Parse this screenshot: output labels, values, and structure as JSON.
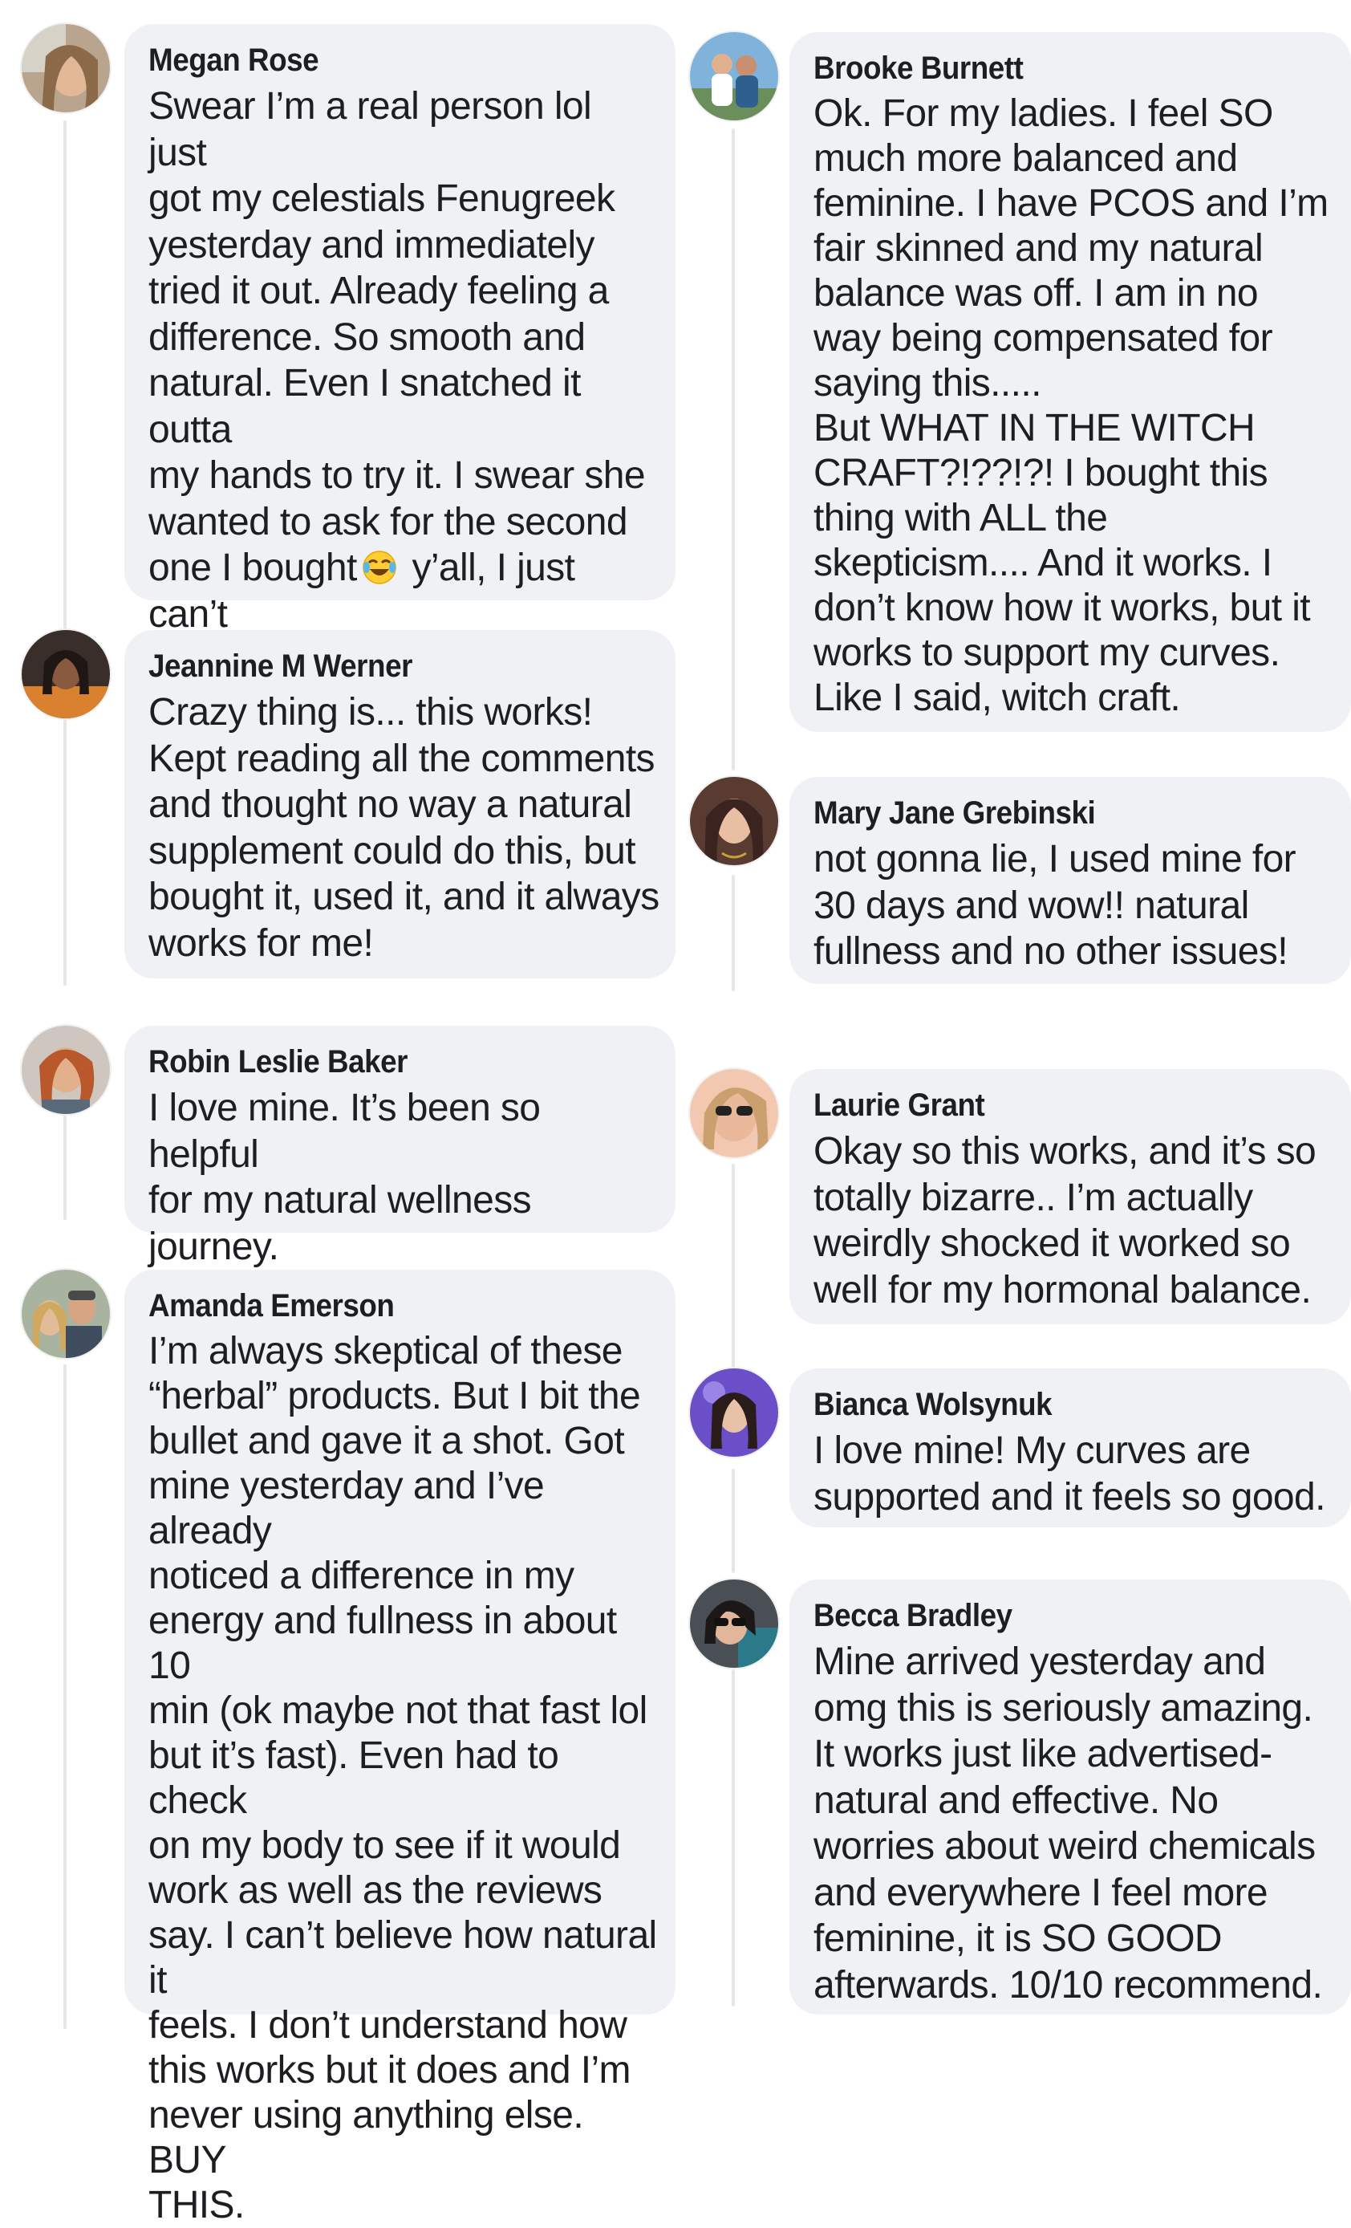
{
  "comments_left": [
    {
      "name": "Megan Rose",
      "avatar_icon": "profile-photo-icon",
      "text_before_emoji": "Swear I’m a real person lol just\ngot my celestials Fenugreek\nyesterday and immediately\ntried it out. Already feeling a\ndifference. So smooth and\nnatural. Even I snatched it outta\nmy hands to try it. I swear she\nwanted to ask for the second\none I bought",
      "emoji": "tears-of-joy-emoji",
      "text_after_emoji": " y’all, I just can’t\nget over how great I feel... get\nthe dang product lmao"
    },
    {
      "name": "Jeannine M Werner",
      "avatar_icon": "profile-photo-icon",
      "text": "Crazy thing is... this works!\nKept reading all the comments\nand thought no way a natural\nsupplement could do this, but\nbought it, used it, and it always\nworks for me!"
    },
    {
      "name": "Robin Leslie Baker",
      "avatar_icon": "profile-photo-icon",
      "text": "I love mine. It’s been so helpful\nfor my natural wellness\njourney."
    },
    {
      "name": "Amanda Emerson",
      "avatar_icon": "profile-photo-icon",
      "text": "I’m always skeptical of these\n“herbal” products. But I bit the\nbullet and gave it a shot. Got\nmine yesterday and I’ve already\nnoticed a difference in my\nenergy and fullness in about 10\nmin (ok maybe not that fast lol\nbut it’s fast). Even had to check\non  my body to see if it would\nwork as well as the reviews\nsay. I can’t believe how natural it\nfeels. I don’t understand how\nthis works but it does and I’m\nnever using anything else. BUY\nTHIS."
    }
  ],
  "comments_right": [
    {
      "name": "Brooke Burnett",
      "avatar_icon": "profile-photo-icon",
      "text": "Ok. For my ladies. I feel SO\nmuch more balanced and\nfeminine. I have PCOS and I’m\nfair skinned and my natural\nbalance was off. I am in no\nway being compensated for\nsaying this.....\nBut WHAT IN THE WITCH\nCRAFT?!??!?! I bought this\nthing with ALL the\nskepticism.... And it works. I\ndon’t know how it works, but it\nworks to support my curves.\nLike I said, witch craft."
    },
    {
      "name": "Mary Jane Grebinski",
      "avatar_icon": "profile-photo-icon",
      "text": "not gonna lie, I used mine for\n30 days and wow!! natural\nfullness and no other issues!"
    },
    {
      "name": "Laurie Grant",
      "avatar_icon": "profile-photo-icon",
      "text": "Okay so this works, and it’s so\ntotally bizarre.. I’m actually\nweirdly shocked it worked so\nwell for my hormonal balance."
    },
    {
      "name": "Bianca Wolsynuk",
      "avatar_icon": "profile-photo-icon",
      "text": "I love mine! My curves are\nsupported and it feels so good."
    },
    {
      "name": "Becca Bradley",
      "avatar_icon": "profile-photo-icon",
      "text": "Mine arrived yesterday and\nomg this is seriously amazing.\nIt works just like advertised-\nnatural and effective. No\nworries about weird chemicals\nand everywhere I feel more\nfeminine,  it is SO GOOD\nafterwards. 10/10 recommend."
    }
  ],
  "colors": {
    "bubble": "#f0f1f4",
    "text": "#1c1e21",
    "thread_line": "#e4e6ea",
    "background": "#ffffff"
  }
}
